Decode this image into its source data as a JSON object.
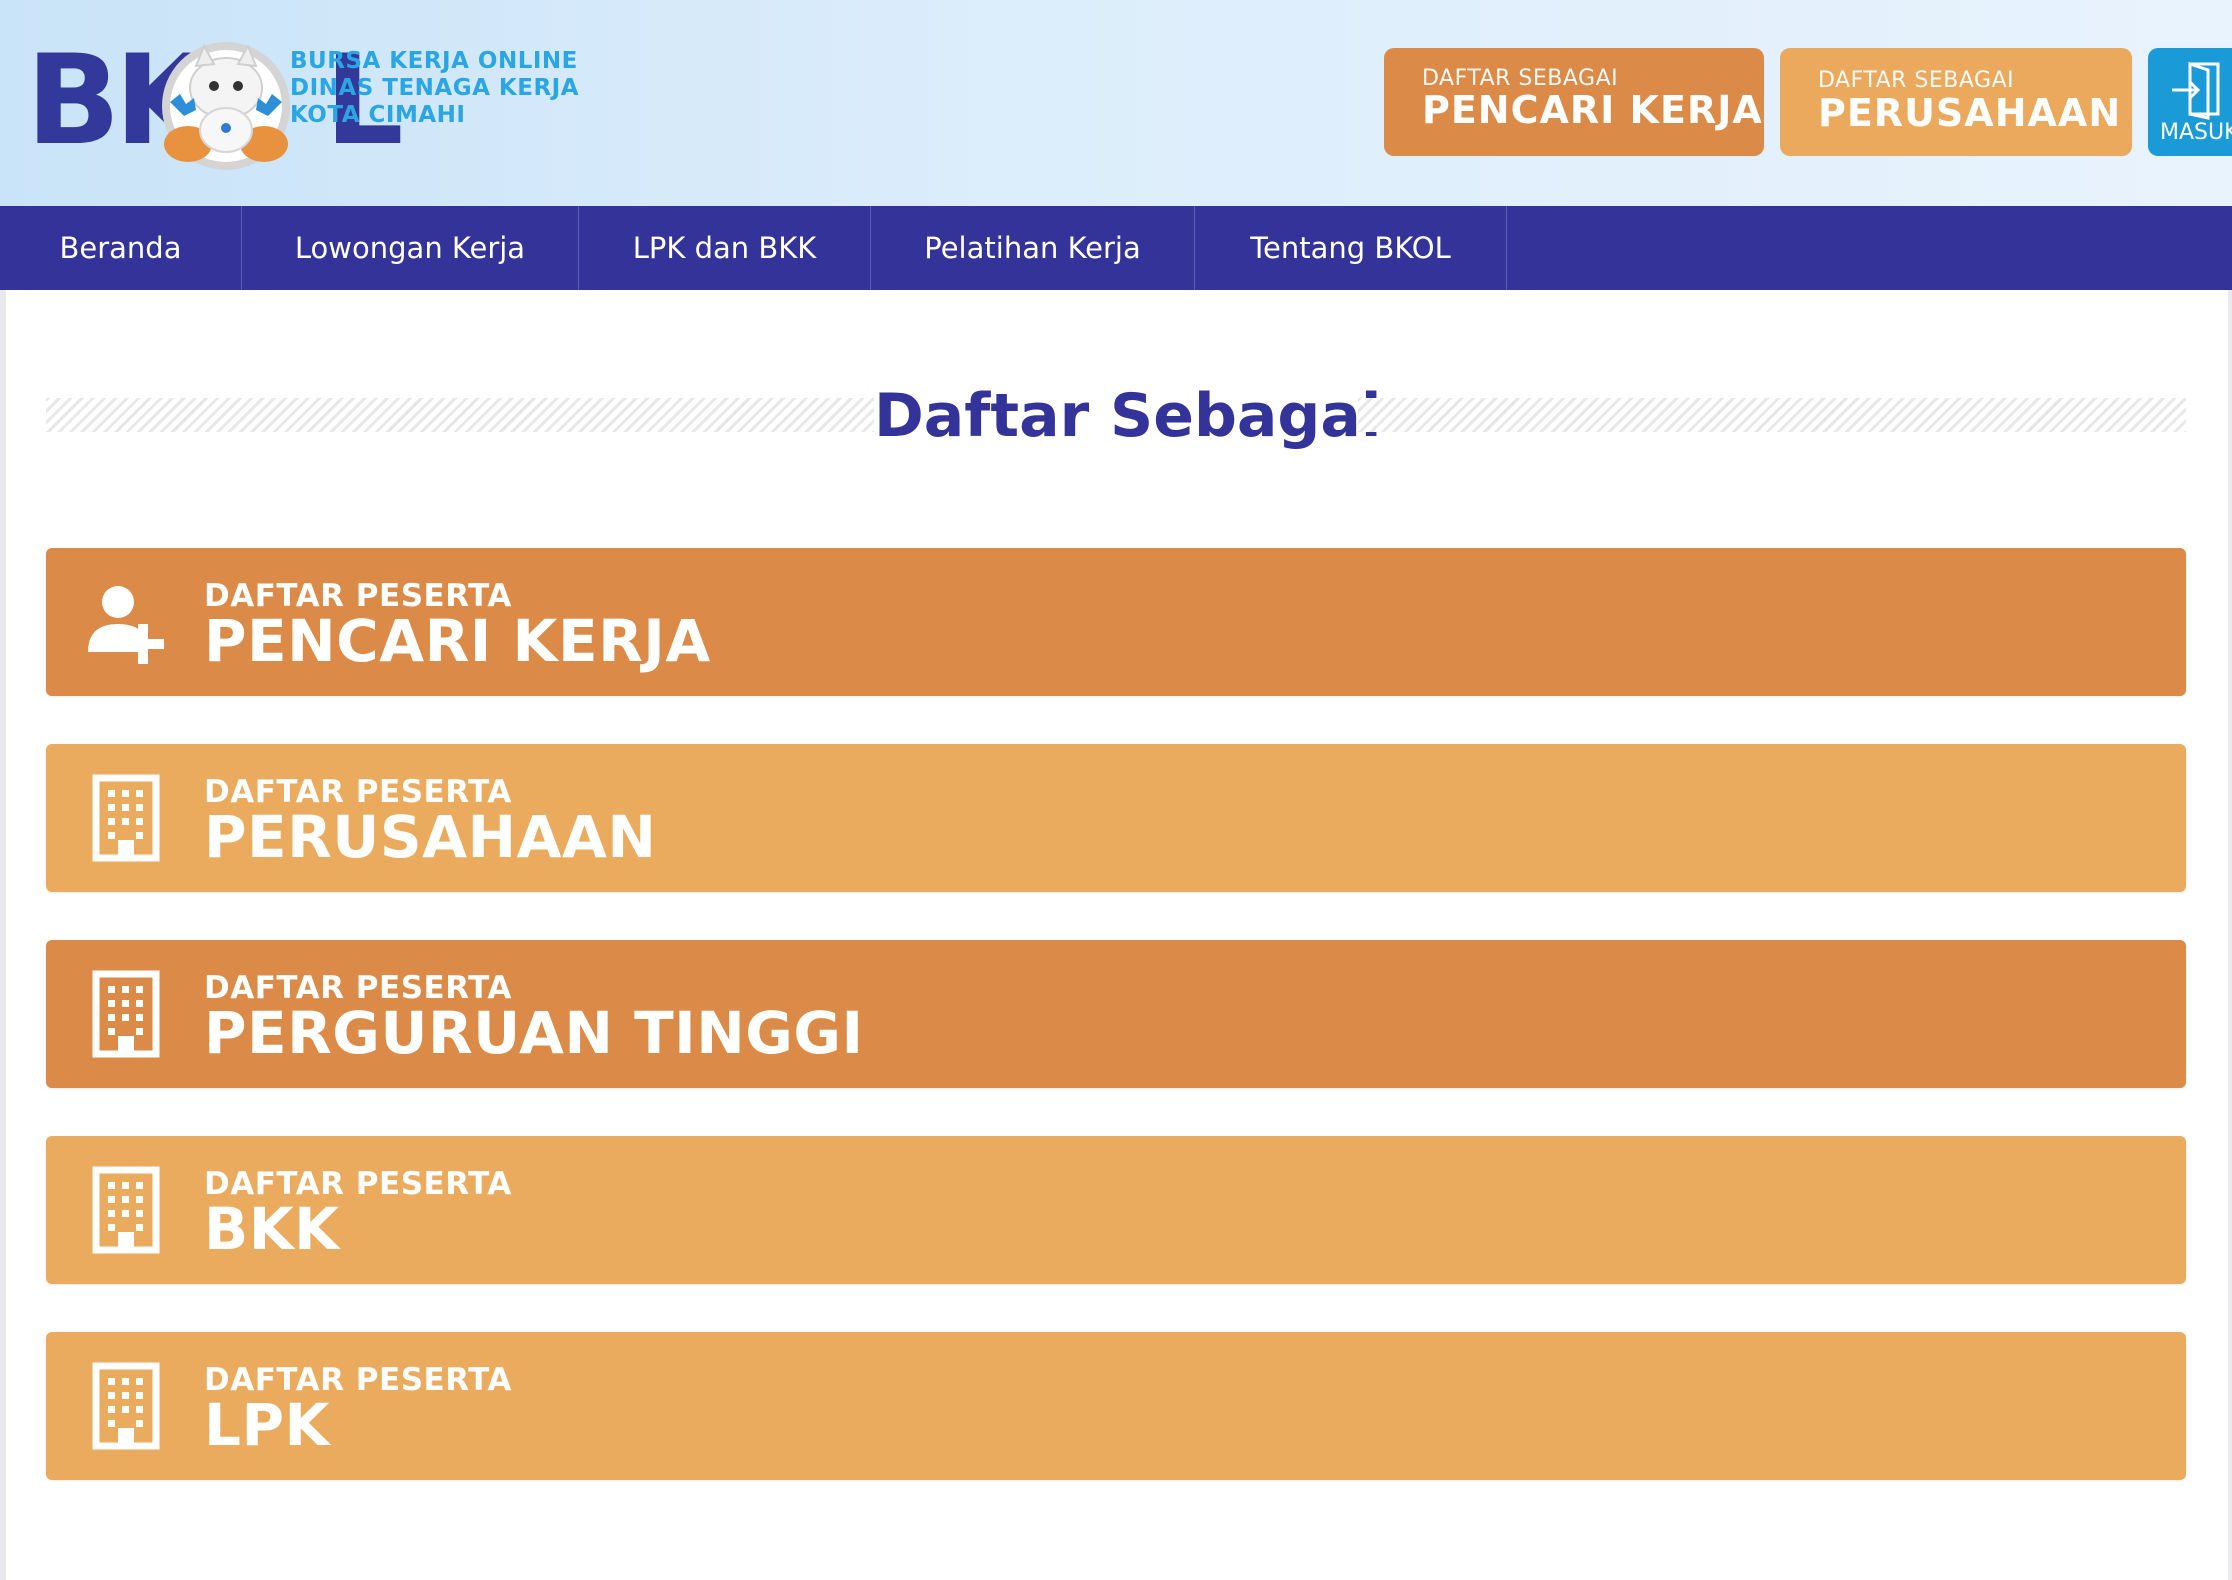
{
  "header": {
    "logo": {
      "letters_left": "BK",
      "letters_right": "L",
      "lines": [
        "BURSA KERJA ONLINE",
        "DINAS TENAGA KERJA",
        "KOTA CIMAHI"
      ]
    },
    "buttons": [
      {
        "small": "DAFTAR SEBAGAI",
        "big": "PENCARI KERJA",
        "color": "#db8a48"
      },
      {
        "small": "DAFTAR SEBAGAI",
        "big": "PERUSAHAAN",
        "color": "#eba95e"
      }
    ],
    "login": {
      "label": "MASUK",
      "color": "#1a9ad6"
    }
  },
  "nav": {
    "items": [
      "Beranda",
      "Lowongan Kerja",
      "LPK dan BKK",
      "Pelatihan Kerja",
      "Tentang BKOL"
    ],
    "color": "#333399"
  },
  "main": {
    "title": "Daftar Sebagai",
    "registrations": [
      {
        "small": "DAFTAR PESERTA",
        "big": "PENCARI KERJA",
        "icon": "user-plus-icon",
        "color": "#db8a48"
      },
      {
        "small": "DAFTAR PESERTA",
        "big": "PERUSAHAAN",
        "icon": "building-icon",
        "color": "#ebab5f"
      },
      {
        "small": "DAFTAR PESERTA",
        "big": "PERGURUAN TINGGI",
        "icon": "building-icon",
        "color": "#db8a48"
      },
      {
        "small": "DAFTAR PESERTA",
        "big": "BKK",
        "icon": "building-icon",
        "color": "#ebab5f"
      },
      {
        "small": "DAFTAR PESERTA",
        "big": "LPK",
        "icon": "building-icon",
        "color": "#ebab5f"
      }
    ]
  }
}
